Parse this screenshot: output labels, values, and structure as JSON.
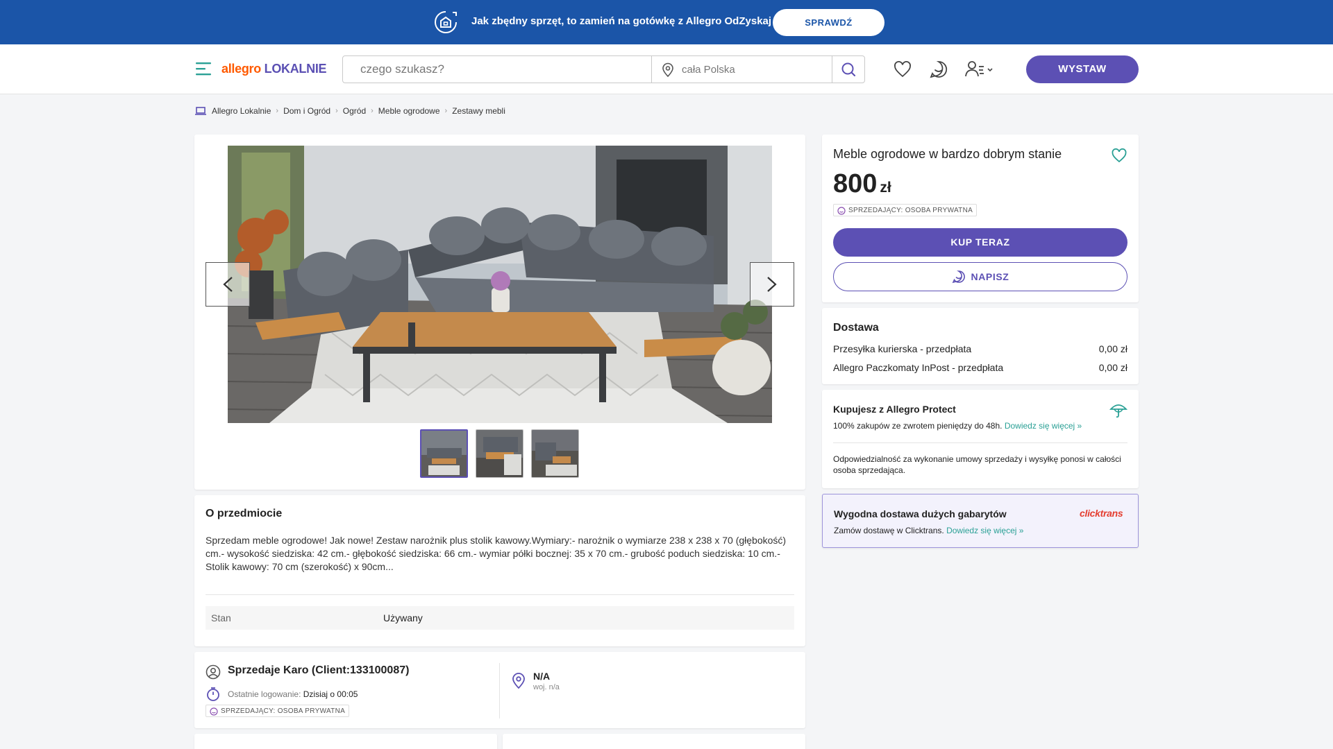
{
  "promo": {
    "text": "Jak zbędny sprzęt, to zamień na gotówkę z Allegro OdZyskaj",
    "button": "SPRAWDŹ",
    "icon": "recycle-box-icon"
  },
  "header": {
    "logo_part1": "allegro",
    "logo_part2": "LOKALNIE",
    "search_placeholder": "czego szukasz?",
    "location_placeholder": "cała Polska",
    "sell_button": "WYSTAW",
    "icons": [
      "menu-icon",
      "heart-icon",
      "chat-icon",
      "user-menu-icon",
      "search-icon",
      "location-icon"
    ]
  },
  "breadcrumb": [
    "Allegro Lokalnie",
    "Dom i Ogród",
    "Ogród",
    "Meble ogrodowe",
    "Zestawy mebli"
  ],
  "gallery": {
    "thumbnail_count": 3,
    "active_index": 0
  },
  "about": {
    "title": "O przedmiocie",
    "description": "Sprzedam meble ogrodowe! Jak nowe! Zestaw narożnik plus stolik kawowy.Wymiary:- narożnik o wymiarze 238 x 238 x 70 (głębokość) cm.- wysokość siedziska: 42 cm.- głębokość siedziska: 66 cm.- wymiar półki bocznej: 35 x 70 cm.- grubość poduch siedziska: 10 cm.- Stolik kawowy: 70 cm (szerokość) x 90cm...",
    "attributes": [
      {
        "key": "Stan",
        "value": "Używany"
      }
    ]
  },
  "seller": {
    "name": "Sprzedaje Karo (Client:133100087)",
    "login_label": "Ostatnie logowanie:",
    "login_value": "Dzisiaj o 00:05",
    "badge": "SPRZEDAJĄCY: OSOBA PRYWATNA",
    "location_name": "N/A",
    "location_region": "woj. n/a"
  },
  "offer": {
    "title": "Meble ogrodowe w bardzo dobrym stanie",
    "price": "800",
    "currency": "zł",
    "badge": "SPRZEDAJĄCY: OSOBA PRYWATNA",
    "buy_button": "KUP TERAZ",
    "message_button": "NAPISZ"
  },
  "delivery": {
    "title": "Dostawa",
    "options": [
      {
        "name": "Przesyłka kurierska - przedpłata",
        "price": "0,00 zł"
      },
      {
        "name": "Allegro Paczkomaty InPost - przedpłata",
        "price": "0,00 zł"
      }
    ]
  },
  "protect": {
    "title": "Kupujesz z Allegro Protect",
    "text": "100% zakupów ze zwrotem pieniędzy do 48h.",
    "link": "Dowiedz się więcej »",
    "note": "Odpowiedzialność za wykonanie umowy sprzedaży i wysyłkę ponosi w całości osoba sprzedająca."
  },
  "clicktrans": {
    "title": "Wygodna dostawa dużych gabarytów",
    "logo": "clicktrans",
    "text": "Zamów dostawę w Clicktrans.",
    "link": "Dowiedz się więcej »"
  },
  "colors": {
    "promo_bg": "#1b55a8",
    "accent": "#5c50b4",
    "link": "#2aa095",
    "allegro_orange": "#ff5a00"
  }
}
